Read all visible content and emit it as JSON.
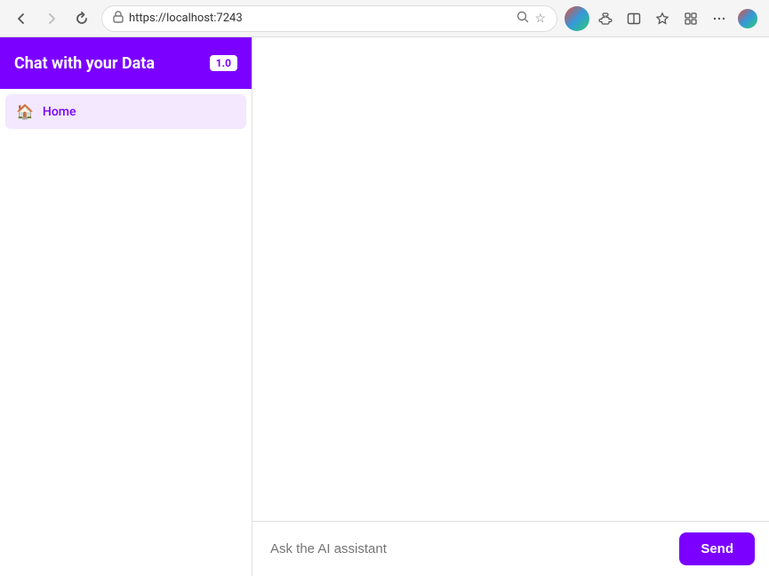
{
  "browser": {
    "url": "https://localhost:7243",
    "back_label": "←",
    "forward_label": "→",
    "refresh_label": "↻",
    "search_icon": "🔍",
    "star_icon": "☆",
    "profile_icon": "👤",
    "extensions_icon": "🧩",
    "split_icon": "⧉",
    "bookmarks_icon": "★",
    "collections_icon": "📁",
    "more_icon": "⋯"
  },
  "sidebar": {
    "title": "Chat with your Data",
    "version": "1.0",
    "nav_items": [
      {
        "id": "home",
        "label": "Home",
        "icon": "🏠"
      }
    ]
  },
  "main": {
    "chat_placeholder": "Ask the AI assistant",
    "send_label": "Send"
  }
}
